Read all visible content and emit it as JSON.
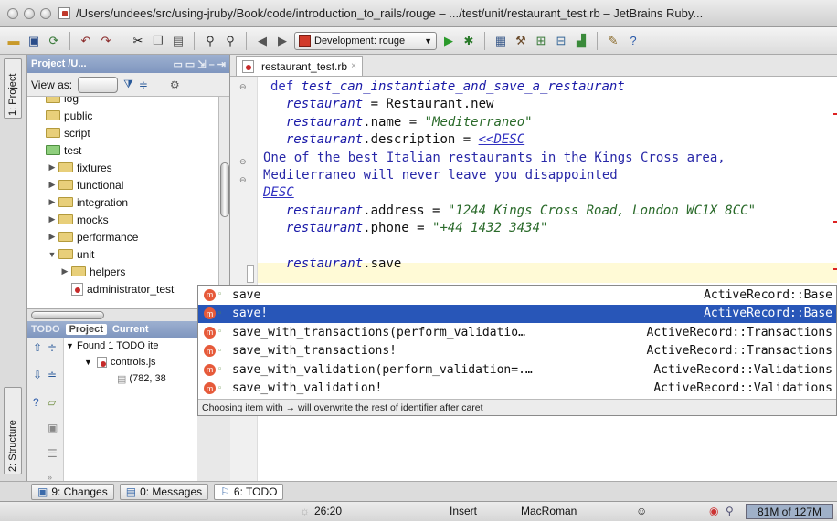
{
  "window": {
    "title": "/Users/undees/src/using-jruby/Book/code/introduction_to_rails/rouge – .../test/unit/restaurant_test.rb – JetBrains Ruby..."
  },
  "toolbar": {
    "run_config": "Development: rouge"
  },
  "left_strip": {
    "project_tab": "1: Project",
    "structure_tab": "2: Structure"
  },
  "project_panel": {
    "header": "Project /U...",
    "view_as_label": "View as:",
    "tree": [
      {
        "label": "log",
        "indent": 0,
        "type": "folder",
        "arrow": ""
      },
      {
        "label": "public",
        "indent": 0,
        "type": "folder",
        "arrow": ""
      },
      {
        "label": "script",
        "indent": 0,
        "type": "folder",
        "arrow": ""
      },
      {
        "label": "test",
        "indent": 0,
        "type": "folder-green",
        "arrow": ""
      },
      {
        "label": "fixtures",
        "indent": 1,
        "type": "folder",
        "arrow": "▶"
      },
      {
        "label": "functional",
        "indent": 1,
        "type": "folder",
        "arrow": "▶"
      },
      {
        "label": "integration",
        "indent": 1,
        "type": "folder",
        "arrow": "▶"
      },
      {
        "label": "mocks",
        "indent": 1,
        "type": "folder",
        "arrow": "▶"
      },
      {
        "label": "performance",
        "indent": 1,
        "type": "folder",
        "arrow": "▶"
      },
      {
        "label": "unit",
        "indent": 1,
        "type": "folder",
        "arrow": "▼"
      },
      {
        "label": "helpers",
        "indent": 2,
        "type": "folder",
        "arrow": "▶"
      },
      {
        "label": "administrator_test",
        "indent": 2,
        "type": "rbfile",
        "arrow": ""
      }
    ]
  },
  "todo_panel": {
    "tabs": [
      "TODO",
      "Project",
      "Current"
    ],
    "found": "Found 1 TODO ite",
    "file": "controls.js",
    "position": "(782, 38"
  },
  "editor": {
    "tab_label": "restaurant_test.rb",
    "lines": [
      [
        {
          "c": "kw",
          "t": "def "
        },
        {
          "c": "var",
          "t": "test_can_instantiate_and_save_a_restaurant"
        }
      ],
      [
        {
          "c": "plain",
          "t": "  "
        },
        {
          "c": "var",
          "t": "restaurant"
        },
        {
          "c": "plain",
          "t": " = Restaurant.new"
        }
      ],
      [
        {
          "c": "plain",
          "t": "  "
        },
        {
          "c": "var",
          "t": "restaurant"
        },
        {
          "c": "plain",
          "t": ".name = "
        },
        {
          "c": "str",
          "t": "\"Mediterraneo\""
        }
      ],
      [
        {
          "c": "plain",
          "t": "  "
        },
        {
          "c": "var",
          "t": "restaurant"
        },
        {
          "c": "plain",
          "t": ".description = "
        },
        {
          "c": "heredoc",
          "t": "<<DESC"
        }
      ],
      [
        {
          "c": "hdbody",
          "t": "One of the best Italian restaurants in the Kings Cross area,"
        }
      ],
      [
        {
          "c": "hdbody",
          "t": "Mediterraneo will never leave you disappointed"
        }
      ],
      [
        {
          "c": "heredoc",
          "t": "DESC"
        }
      ],
      [
        {
          "c": "plain",
          "t": "  "
        },
        {
          "c": "var",
          "t": "restaurant"
        },
        {
          "c": "plain",
          "t": ".address = "
        },
        {
          "c": "strfill",
          "t": "\"1244 Kings Cross Road, London WC1X 8CC\""
        }
      ],
      [
        {
          "c": "plain",
          "t": "  "
        },
        {
          "c": "var",
          "t": "restaurant"
        },
        {
          "c": "plain",
          "t": ".phone = "
        },
        {
          "c": "strfill",
          "t": "\"+44 1432 3434\""
        }
      ],
      [
        {
          "c": "plain",
          "t": ""
        }
      ],
      [
        {
          "c": "plain",
          "t": "  "
        },
        {
          "c": "var",
          "t": "restaurant"
        },
        {
          "c": "plain",
          "t": ".save"
        }
      ]
    ]
  },
  "completion": {
    "items": [
      {
        "name": "save",
        "type": "ActiveRecord::Base",
        "selected": false
      },
      {
        "name": "save!",
        "type": "ActiveRecord::Base",
        "selected": true
      },
      {
        "name": "save_with_transactions(perform_validatio…",
        "type": "ActiveRecord::Transactions",
        "selected": false
      },
      {
        "name": "save_with_transactions!",
        "type": "ActiveRecord::Transactions",
        "selected": false
      },
      {
        "name": "save_with_validation(perform_validation=.…",
        "type": "ActiveRecord::Validations",
        "selected": false
      },
      {
        "name": "save_with_validation!",
        "type": "ActiveRecord::Validations",
        "selected": false
      }
    ],
    "hint": "Choosing item with → will overwrite the rest of identifier after caret"
  },
  "bottom_tabs": [
    {
      "label": "9: Changes",
      "active": false
    },
    {
      "label": "0: Messages",
      "active": false
    },
    {
      "label": "6: TODO",
      "active": true
    }
  ],
  "status": {
    "position": "26:20",
    "mode": "Insert",
    "encoding": "MacRoman",
    "memory": "81M of 127M"
  },
  "colors": {
    "selection": "#2856b8",
    "panel_header": "#8fa3c8",
    "current_line": "#fffad6"
  }
}
